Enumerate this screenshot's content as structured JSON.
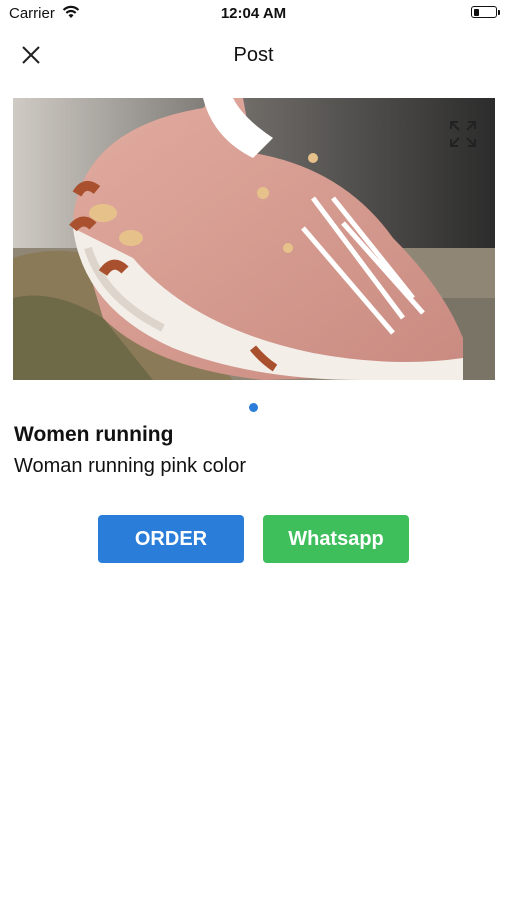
{
  "status_bar": {
    "carrier": "Carrier",
    "time": "12:04 AM",
    "battery_level": 0.25
  },
  "nav": {
    "title": "Post",
    "close_icon": "close-icon"
  },
  "post": {
    "title": "Women running",
    "description": "Woman running pink color",
    "image_count": 1,
    "active_image": 1
  },
  "actions": {
    "order_label": "ORDER",
    "whatsapp_label": "Whatsapp"
  },
  "colors": {
    "primary": "#2a7dd8",
    "whatsapp": "#3ebf5c"
  }
}
